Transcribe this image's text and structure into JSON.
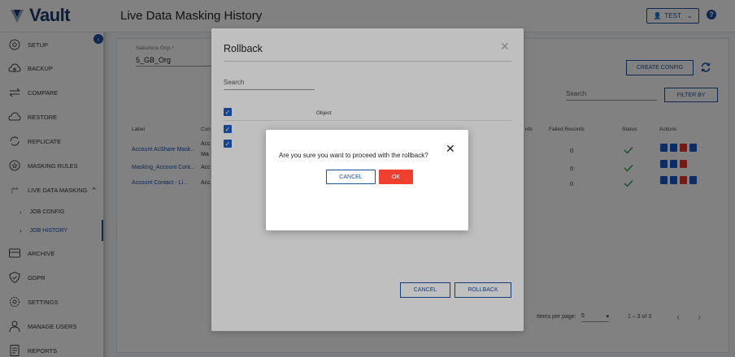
{
  "app": {
    "logo_text": "Vault",
    "page_title": "Live Data Masking History"
  },
  "header": {
    "user_label": "TEST",
    "help_label": "?"
  },
  "sidebar": {
    "items": [
      {
        "label": "SETUP",
        "icon": "gear-icon"
      },
      {
        "label": "BACKUP",
        "icon": "cloud-up-icon"
      },
      {
        "label": "COMPARE",
        "icon": "arrows-icon"
      },
      {
        "label": "RESTORE",
        "icon": "cloud-restore-icon"
      },
      {
        "label": "REPLICATE",
        "icon": "replicate-icon"
      },
      {
        "label": "MASKING RULES",
        "icon": "mask-icon"
      },
      {
        "label": "LIVE DATA MASKING",
        "icon": "asterisk-icon"
      },
      {
        "label": "JOB CONFIG",
        "icon": "chevron-right-icon"
      },
      {
        "label": "JOB HISTORY",
        "icon": "chevron-right-icon"
      },
      {
        "label": "ARCHIVE",
        "icon": "archive-icon"
      },
      {
        "label": "GDPR",
        "icon": "shield-icon"
      },
      {
        "label": "SETTINGS",
        "icon": "settings-icon"
      },
      {
        "label": "MANAGE USERS",
        "icon": "users-icon"
      },
      {
        "label": "REPORTS",
        "icon": "report-icon"
      }
    ]
  },
  "main": {
    "org_label": "Salesforce Orgs *",
    "org_value": "5_GB_Org",
    "create_config": "CREATE CONFIG",
    "search_placeholder": "Search",
    "filter_by": "FILTER BY",
    "columns": [
      "Label",
      "Con",
      "rds",
      "Failed Records",
      "Status",
      "Actions"
    ],
    "rows": [
      {
        "label": "Account AcShare Mask...",
        "con": "Acc",
        "con2": "Ma",
        "failed": "0"
      },
      {
        "label": "Masking_Account Cont...",
        "con": "Acc",
        "failed": "0"
      },
      {
        "label": "Account Contact - Li...",
        "con": "Acc",
        "failed": "0"
      }
    ],
    "pagination": {
      "items_label": "Items per page:",
      "page_size": "5",
      "range": "1 – 3 of 3"
    }
  },
  "rollback_modal": {
    "title": "Rollback",
    "search_placeholder": "Search",
    "object_header": "Object",
    "cancel": "CANCEL",
    "rollback": "ROLLBACK"
  },
  "confirm_dialog": {
    "message": "Are you sure you want to proceed with the rollback?",
    "cancel": "CANCEL",
    "ok": "OK"
  },
  "colors": {
    "primary": "#1d4fa0",
    "danger": "#f04130",
    "success": "#2e9e4a"
  }
}
